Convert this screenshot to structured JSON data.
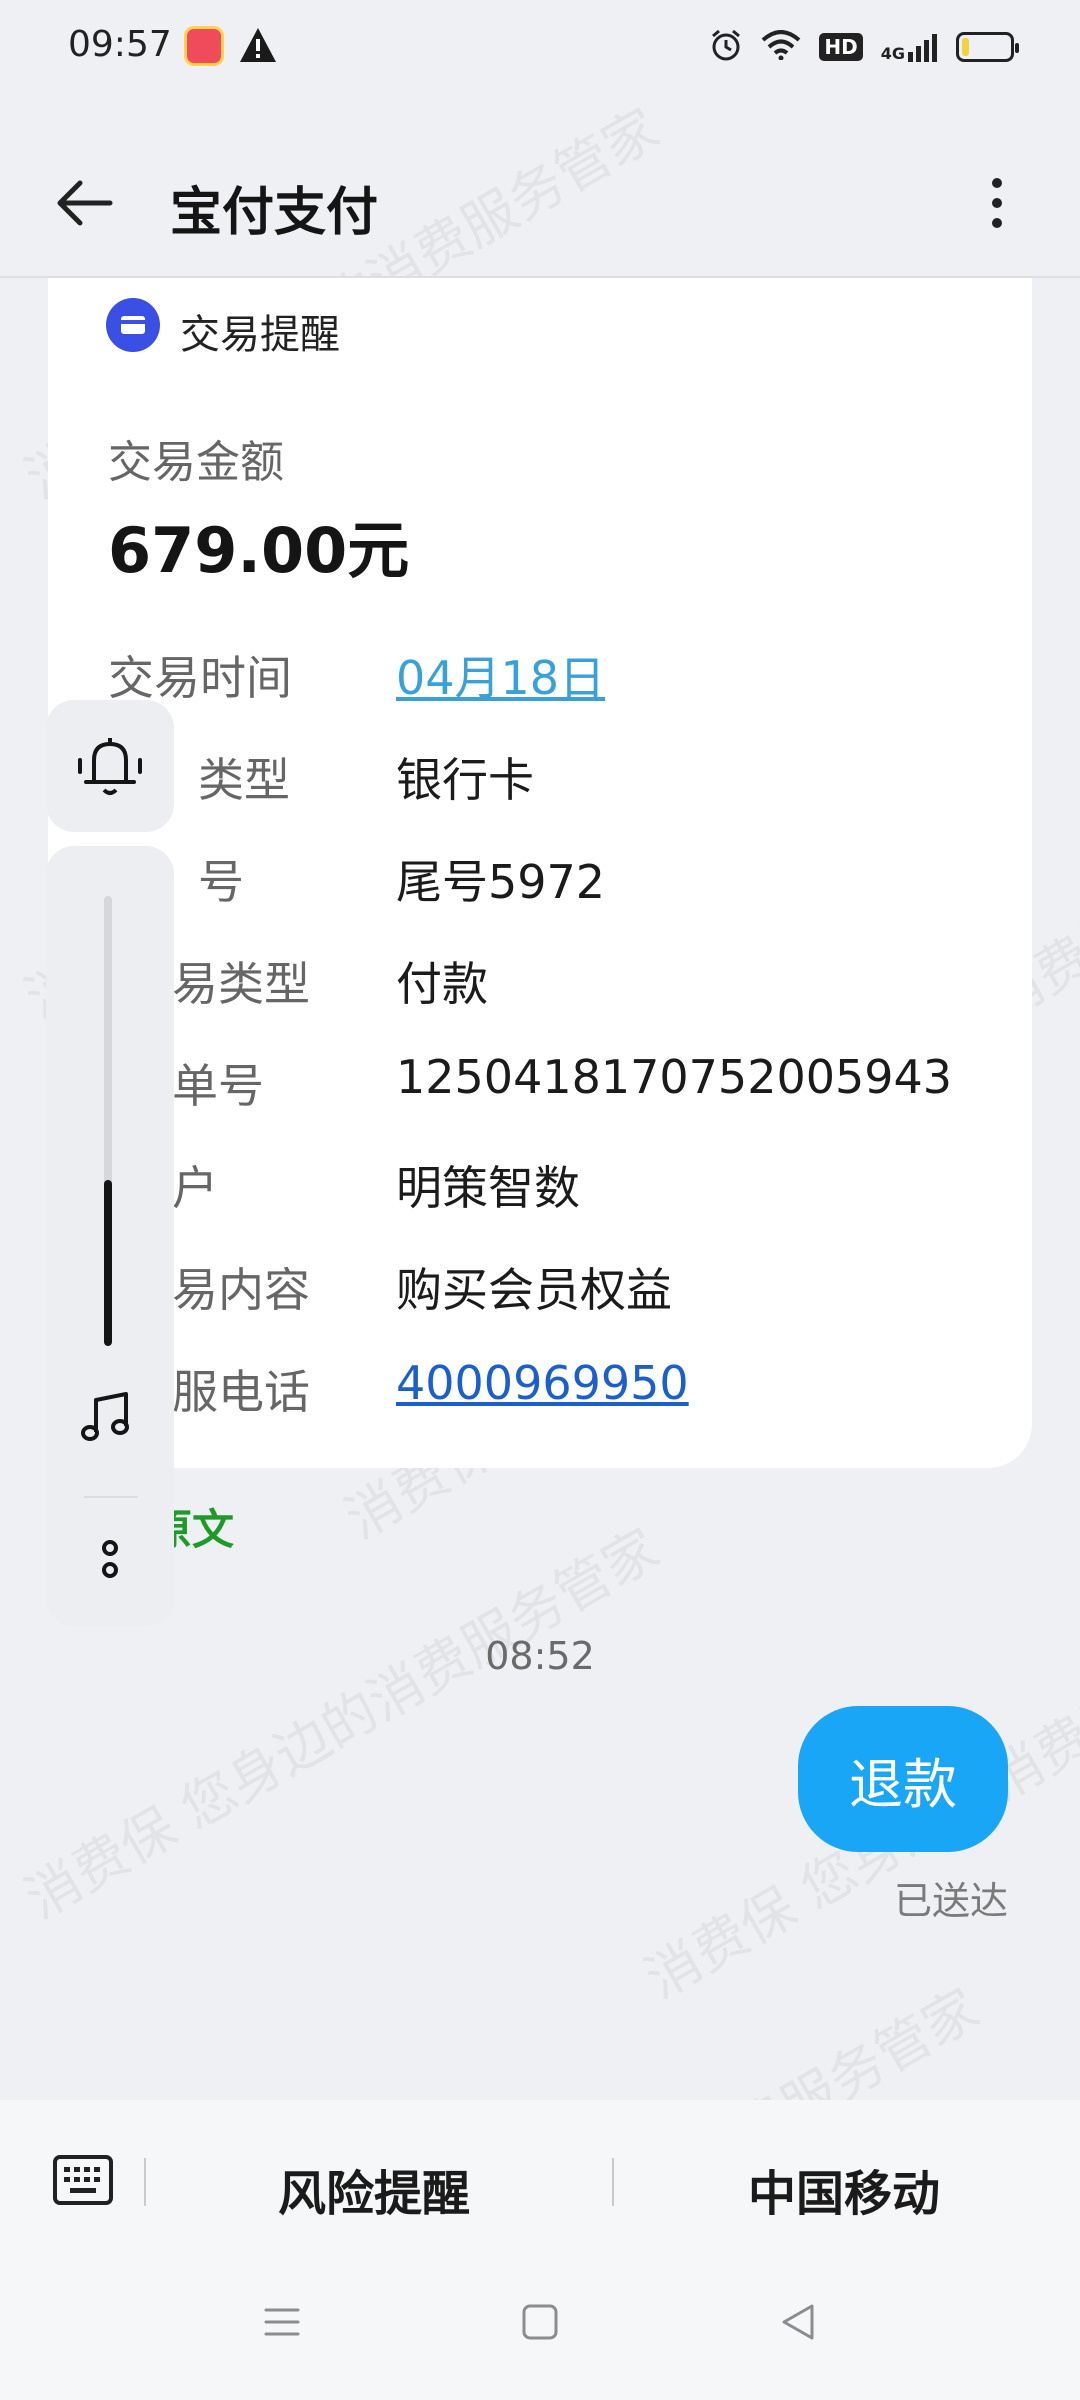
{
  "status_bar": {
    "time": "09:57",
    "hd_label": "HD",
    "signal_label": "4G",
    "battery_level": 0.25,
    "icons": [
      "app-notification-icon",
      "warning-icon",
      "alarm-icon",
      "wifi-icon",
      "hd-icon",
      "signal-icon",
      "battery-icon"
    ]
  },
  "header": {
    "title": "宝付支付"
  },
  "card": {
    "title": "交易提醒",
    "amount_label": "交易金额",
    "amount_value": "679.00元",
    "rows": [
      {
        "label": "交易时间",
        "value": "04月18日"
      },
      {
        "label": "类型",
        "value": "银行卡"
      },
      {
        "label": "号",
        "value": "尾号5972"
      },
      {
        "label": "易类型",
        "value": "付款"
      },
      {
        "label": "单号",
        "value": "1250418170752005943"
      },
      {
        "label": "户",
        "value": "明策智数"
      },
      {
        "label": "易内容",
        "value": "购买会员权益"
      },
      {
        "label": "服电话",
        "value": "4000969950"
      }
    ]
  },
  "view_original": "看原文",
  "volume_level": 0.37,
  "message": {
    "timestamp": "08:52",
    "text": "退款",
    "status": "已送达"
  },
  "bottom_bar": {
    "menu_left": "风险提醒",
    "menu_right": "中国移动"
  },
  "watermark_text": "消费保 您身边的消费服务管家",
  "colors": {
    "accent_blue": "#1aa6f7",
    "link_blue": "#3aa1d8",
    "card_icon": "#3a4fe4",
    "view_original_green": "#1f9a28"
  }
}
